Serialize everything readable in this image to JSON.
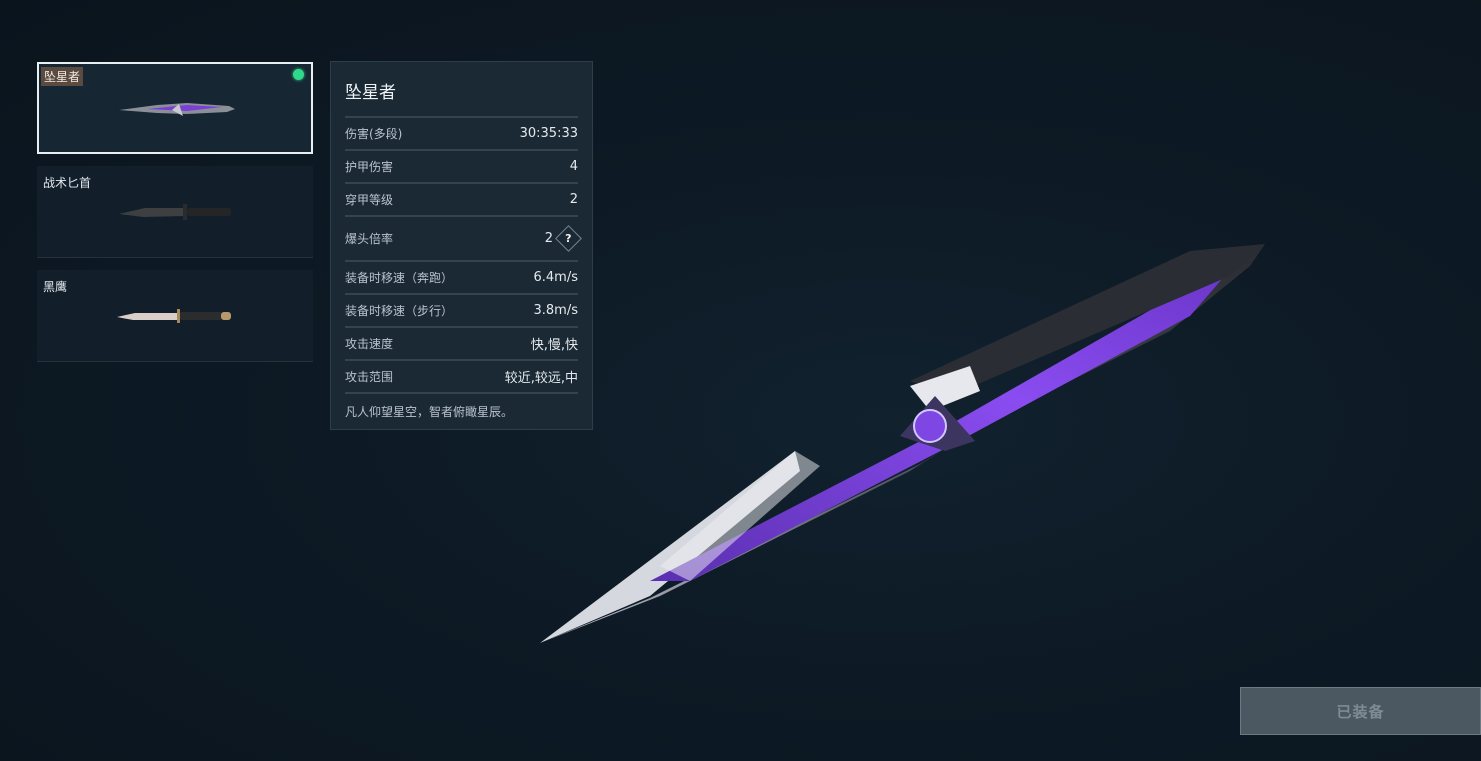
{
  "weapons": [
    {
      "name": "坠星者",
      "selected": true,
      "equipped": true
    },
    {
      "name": "战术匕首",
      "selected": false,
      "equipped": false
    },
    {
      "name": "黑鹰",
      "selected": false,
      "equipped": false
    }
  ],
  "stats": {
    "title": "坠星者",
    "rows": [
      {
        "label": "伤害(多段)",
        "value": "30:35:33"
      },
      {
        "label": "护甲伤害",
        "value": "4"
      },
      {
        "label": "穿甲等级",
        "value": "2"
      },
      {
        "label": "爆头倍率",
        "value": "2",
        "help_icon": "question-icon"
      },
      {
        "label": "装备时移速（奔跑）",
        "value": "6.4m/s"
      },
      {
        "label": "装备时移速（步行）",
        "value": "3.8m/s"
      },
      {
        "label": "攻击速度",
        "value": "快,慢,快"
      },
      {
        "label": "攻击范围",
        "value": "较近,较远,中"
      }
    ],
    "description": "凡人仰望星空，智者俯瞰星辰。"
  },
  "equip_button": {
    "label": "已装备"
  },
  "colors": {
    "equipped_dot": "#2fd98c",
    "accent_purple": "#7b3fd6"
  }
}
